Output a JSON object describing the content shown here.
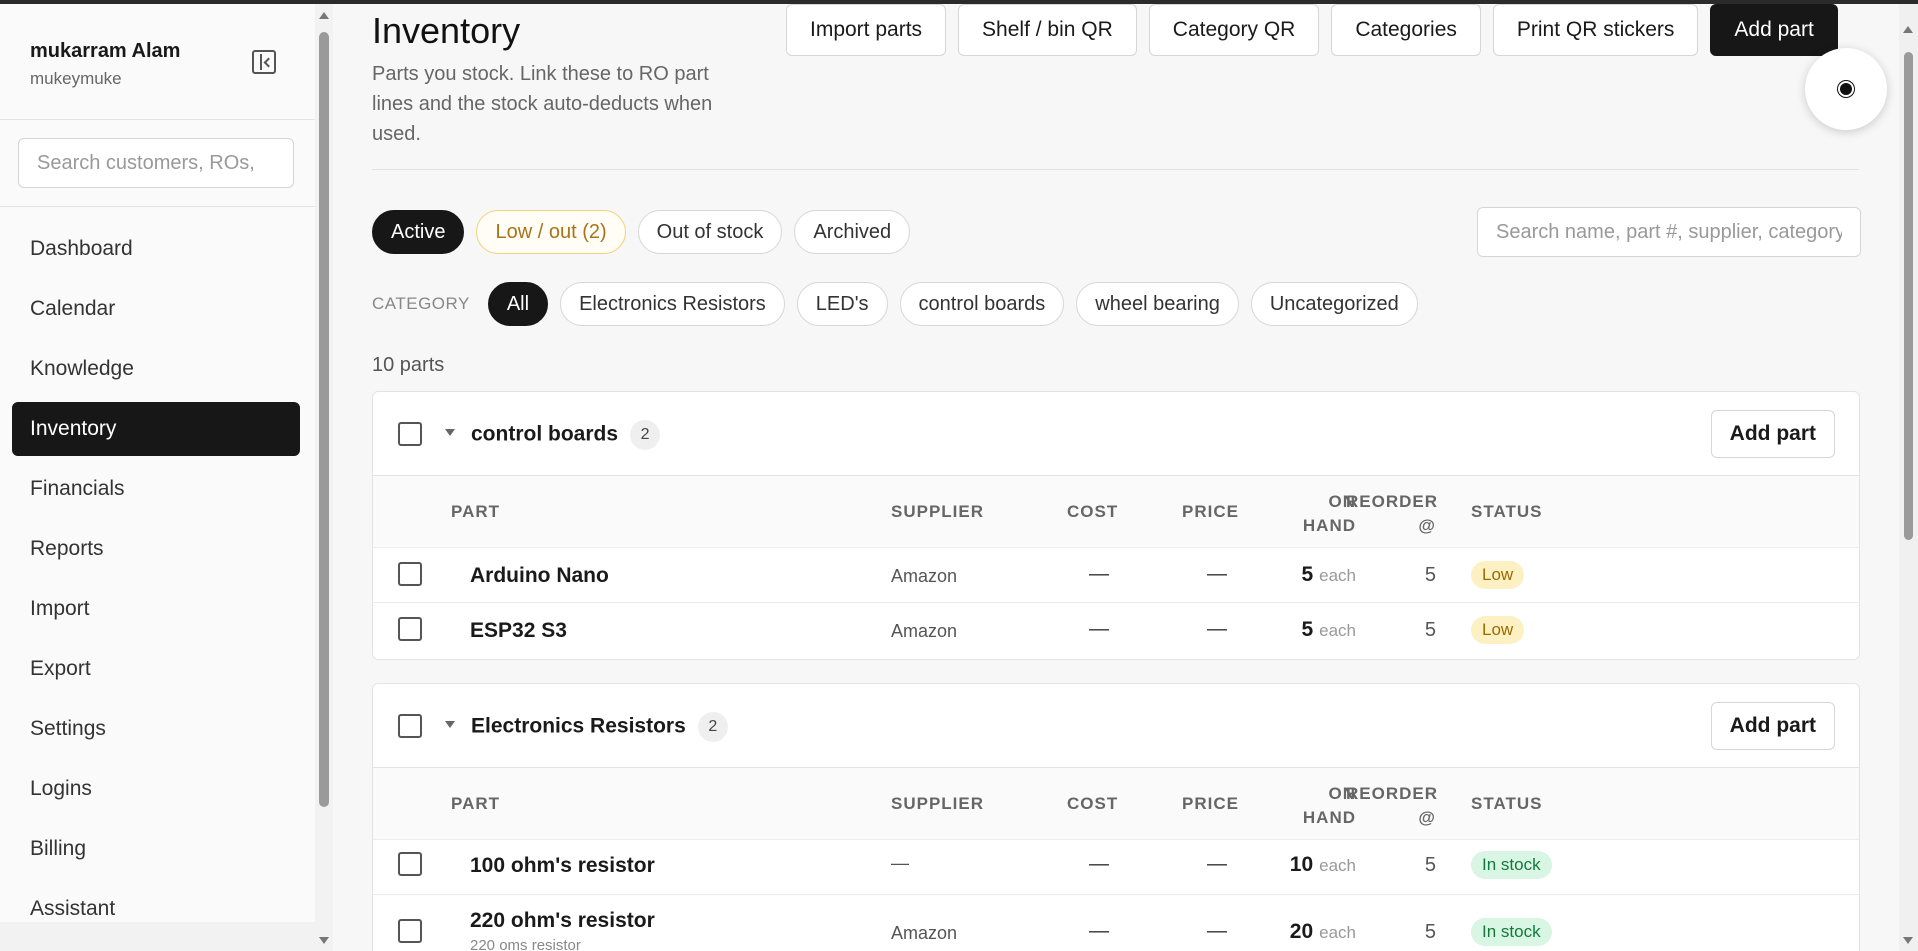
{
  "sidebar": {
    "user_name": "mukarram Alam",
    "user_handle": "mukeymuke",
    "search_placeholder": "Search customers, ROs,",
    "items": [
      {
        "label": "Dashboard"
      },
      {
        "label": "Calendar"
      },
      {
        "label": "Knowledge"
      },
      {
        "label": "Inventory",
        "active": true
      },
      {
        "label": "Financials"
      },
      {
        "label": "Reports"
      },
      {
        "label": "Import"
      },
      {
        "label": "Export"
      },
      {
        "label": "Settings"
      },
      {
        "label": "Logins"
      },
      {
        "label": "Billing"
      },
      {
        "label": "Assistant"
      }
    ]
  },
  "header": {
    "title": "Inventory",
    "description": "Parts you stock. Link these to RO part lines and the stock auto-deducts when used.",
    "actions": {
      "import": "Import parts",
      "shelf_qr": "Shelf / bin QR",
      "category_qr": "Category QR",
      "categories": "Categories",
      "print_qr": "Print QR stickers",
      "add_part": "Add part"
    }
  },
  "filters": {
    "status_tabs": [
      "Active",
      "Low / out (2)",
      "Out of stock",
      "Archived"
    ],
    "search_placeholder": "Search name, part #, supplier, category",
    "category_label": "CATEGORY",
    "categories": [
      "All",
      "Electronics Resistors",
      "LED's",
      "control boards",
      "wheel bearing",
      "Uncategorized"
    ]
  },
  "parts_count": "10 parts",
  "columns": {
    "part": "PART",
    "supplier": "SUPPLIER",
    "cost": "COST",
    "price": "PRICE",
    "on_hand_1": "ON",
    "on_hand_2": "HAND",
    "reorder_1": "REORDER",
    "reorder_2": "@",
    "status": "STATUS"
  },
  "groups": [
    {
      "name": "control boards",
      "count": "2",
      "add_label": "Add part",
      "rows": [
        {
          "name": "Arduino Nano",
          "supplier": "Amazon",
          "cost": "—",
          "price": "—",
          "on_hand": "5",
          "unit": "each",
          "reorder": "5",
          "status": "Low"
        },
        {
          "name": "ESP32 S3",
          "supplier": "Amazon",
          "cost": "—",
          "price": "—",
          "on_hand": "5",
          "unit": "each",
          "reorder": "5",
          "status": "Low"
        }
      ]
    },
    {
      "name": "Electronics Resistors",
      "count": "2",
      "add_label": "Add part",
      "rows": [
        {
          "name": "100 ohm's resistor",
          "subtitle": "",
          "supplier": "—",
          "cost": "—",
          "price": "—",
          "on_hand": "10",
          "unit": "each",
          "reorder": "5",
          "status": "In stock"
        },
        {
          "name": "220 ohm's resistor",
          "subtitle": "220 oms resistor",
          "supplier": "Amazon",
          "cost": "—",
          "price": "—",
          "on_hand": "20",
          "unit": "each",
          "reorder": "5",
          "status": "In stock"
        }
      ]
    }
  ],
  "colors": {
    "accent_dark": "#171717",
    "low_badge": "#fdf1c4",
    "in_stock_badge": "#d9f5e4",
    "warn_pill": "#a8741a"
  }
}
